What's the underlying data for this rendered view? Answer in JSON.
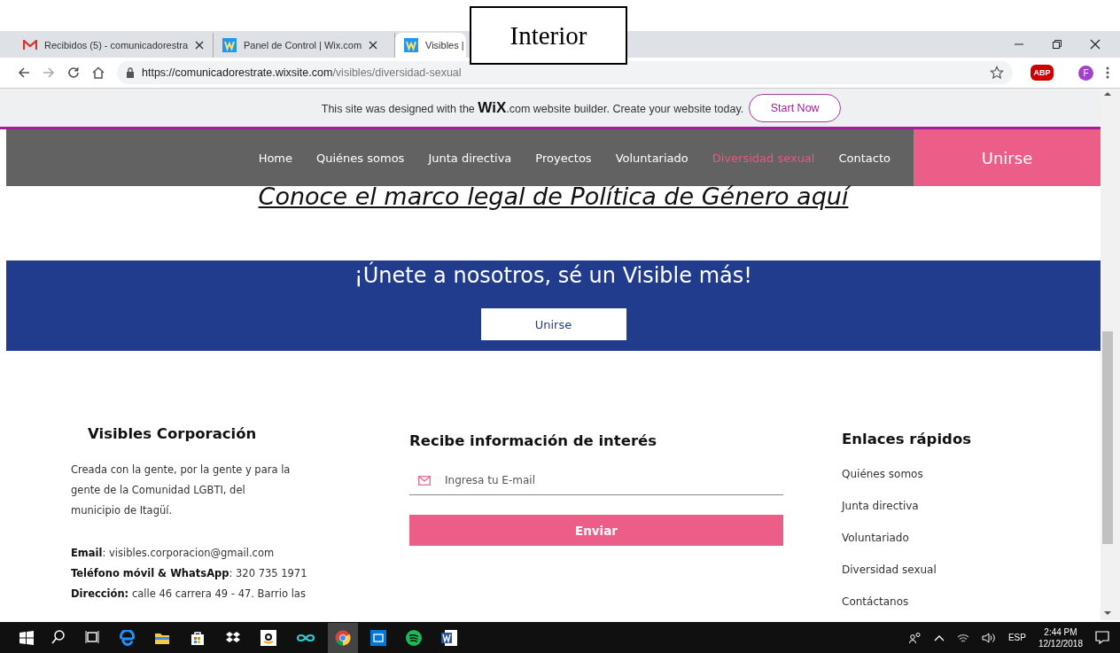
{
  "annotation": {
    "label": "Interior"
  },
  "browser": {
    "tabs": [
      {
        "title": "Recibidos (5) - comunicadorestra",
        "kind": "mail",
        "selected": false
      },
      {
        "title": "Panel de Control | Wix.com",
        "kind": "wix",
        "selected": false
      },
      {
        "title": "Visibles |",
        "kind": "wix",
        "selected": true
      }
    ],
    "url": {
      "host": "https://comunicadorestrate.wixsite.com",
      "path": "/visibles/diversidad-sexual"
    },
    "profile": "F",
    "extension": "ABP"
  },
  "wix_banner": {
    "before": "This site was designed with the",
    "logo": "WiX",
    "logo_suffix": ".com",
    "after": "website builder. Create your website today.",
    "button": "Start Now"
  },
  "nav": {
    "items": [
      {
        "label": "Home",
        "selected": false
      },
      {
        "label": "Quiénes somos",
        "selected": false
      },
      {
        "label": "Junta directiva",
        "selected": false
      },
      {
        "label": "Proyectos",
        "selected": false
      },
      {
        "label": "Voluntariado",
        "selected": false
      },
      {
        "label": "Diversidad sexual",
        "selected": true
      },
      {
        "label": "Contacto",
        "selected": false
      }
    ],
    "cta": "Unirse"
  },
  "legal_link": "Conoce el marco legal de Política de Género aquí",
  "join": {
    "heading": "¡Únete a nosotros, sé un Visible más!",
    "button": "Unirse"
  },
  "footer": {
    "about": {
      "title": "Visibles Corporación",
      "text": "Creada con la gente, por la gente y para la gente de la Comunidad LGBTI, del municipio de Itagüí.",
      "contacts": [
        "**Email**: visibles.corporacion@gmail.com",
        "**Teléfono móvil & WhatsApp**: 320 735 1971",
        "**Dirección:** calle 46 carrera 49 - 47. Barrio las"
      ]
    },
    "newsletter": {
      "title": "Recibe información de interés",
      "placeholder": "Ingresa tu E-mail",
      "button": "Enviar"
    },
    "links": {
      "title": "Enlaces rápidos",
      "items": [
        "Quiénes somos",
        "Junta directiva",
        "Voluntariado",
        "Diversidad sexual",
        "Contáctanos"
      ]
    }
  },
  "taskbar": {
    "apps": [
      {
        "kind": "search",
        "selected": false
      },
      {
        "kind": "taskview",
        "selected": false
      },
      {
        "kind": "edge",
        "selected": false
      },
      {
        "kind": "folder",
        "selected": false
      },
      {
        "kind": "store",
        "selected": false
      },
      {
        "kind": "dropbox",
        "selected": false
      },
      {
        "kind": "amazon",
        "selected": false
      },
      {
        "kind": "infinity",
        "selected": false
      },
      {
        "kind": "chrome",
        "selected": true
      },
      {
        "kind": "outlook",
        "selected": false
      },
      {
        "kind": "spotify",
        "selected": false
      },
      {
        "kind": "word",
        "selected": false
      }
    ],
    "language": "ESP",
    "time": "2:44 PM",
    "date": "12/12/2018"
  }
}
